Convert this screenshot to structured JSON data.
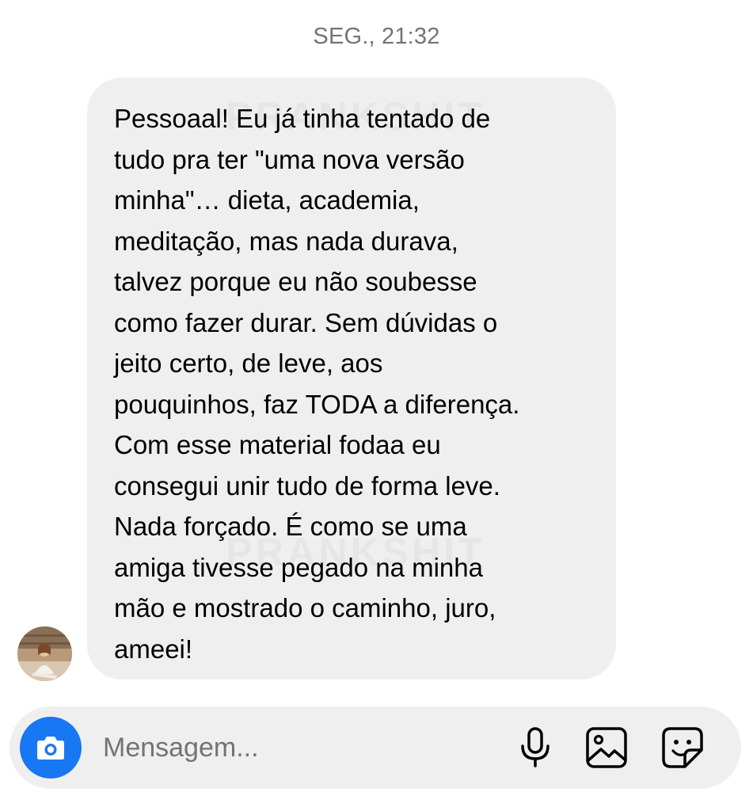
{
  "thread": {
    "timestamp": "SEG., 21:32"
  },
  "message": {
    "text": "Pessoaal! Eu já tinha tentado de\ntudo pra ter \"uma nova versão\nminha\"… dieta, academia,\nmeditação, mas nada durava,\ntalvez porque eu não soubesse\ncomo fazer durar. Sem dúvidas o\njeito certo, de leve, aos\npouquinhos, faz TODA a diferença.\nCom esse material fodaa eu\nconsegui unir tudo de forma leve.\nNada forçado. É como se uma\namiga tivesse pegado na minha\nmão e mostrado o caminho, juro,\nameei!",
    "watermark": "PRANKSHIT"
  },
  "composer": {
    "placeholder": "Mensagem...",
    "value": ""
  },
  "icons": {
    "camera": "camera-icon",
    "mic": "microphone-icon",
    "gallery": "image-gallery-icon",
    "sticker": "sticker-icon"
  },
  "colors": {
    "accent": "#1877f2",
    "bubble": "#efefef",
    "timestamp": "#737373",
    "text": "#000000"
  }
}
